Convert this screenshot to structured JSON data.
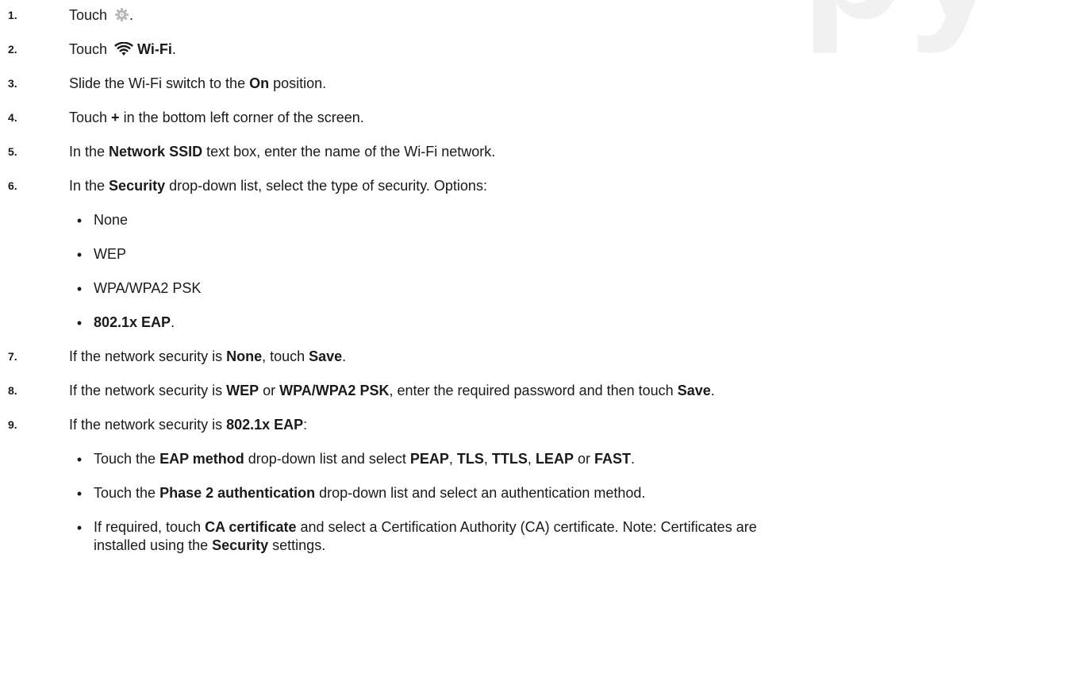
{
  "watermark": "py",
  "steps": {
    "s1": {
      "num": "1.",
      "text": "Touch ",
      "tail": "."
    },
    "s2": {
      "num": "2.",
      "text": "Touch ",
      "bold": "Wi-Fi",
      "tail": "."
    },
    "s3": {
      "num": "3.",
      "a": "Slide the Wi-Fi switch to the ",
      "b": "On",
      "c": " position."
    },
    "s4": {
      "num": "4.",
      "a": "Touch ",
      "b": "+",
      "c": " in the bottom left corner of the screen."
    },
    "s5": {
      "num": "5.",
      "a": "In the ",
      "b": "Network SSID",
      "c": " text box, enter the name of the Wi-Fi network."
    },
    "s6": {
      "num": "6.",
      "a": "In the ",
      "b": "Security",
      "c": " drop-down list, select the type of security. Options:"
    },
    "s6_options": [
      "None",
      "WEP",
      "WPA/WPA2 PSK",
      "802.1x EAP",
      "."
    ],
    "s7": {
      "num": "7.",
      "a": "If the network security is ",
      "b": "None",
      "c": ", touch ",
      "d": "Save",
      "e": "."
    },
    "s8": {
      "num": "8.",
      "a": "If the network security is ",
      "b": "WEP",
      "c": " or ",
      "d": "WPA/WPA2 PSK",
      "e": ", enter the required password and then touch ",
      "f": "Save",
      "g": "."
    },
    "s9": {
      "num": "9.",
      "a": "If the network security is ",
      "b": "802.1x EAP",
      "c": ":"
    },
    "s9_b1": {
      "a": "Touch the ",
      "b": "EAP method",
      "c": " drop-down list and select ",
      "d": "PEAP",
      "e": ", ",
      "f": "TLS",
      "g": ", ",
      "h": "TTLS",
      "i": ", ",
      "j": "LEAP",
      "k": " or ",
      "l": "FAST",
      "m": "."
    },
    "s9_b2": {
      "a": "Touch the ",
      "b": "Phase 2 authentication",
      "c": " drop-down list and select an authentication method."
    },
    "s9_b3": {
      "a": "If required, touch ",
      "b": "CA certificate",
      "c": " and select a Certification Authority (CA) certificate. Note: Certificates are",
      "d": "installed using the ",
      "e": "Security",
      "f": " settings."
    }
  },
  "bullet": "•",
  "icons": {
    "settings": "gear-icon",
    "wifi": "wifi-icon"
  },
  "colors": {
    "text": "#1a1a1a",
    "watermark": "#f1f1f1",
    "gear": "#b8b8b8"
  }
}
